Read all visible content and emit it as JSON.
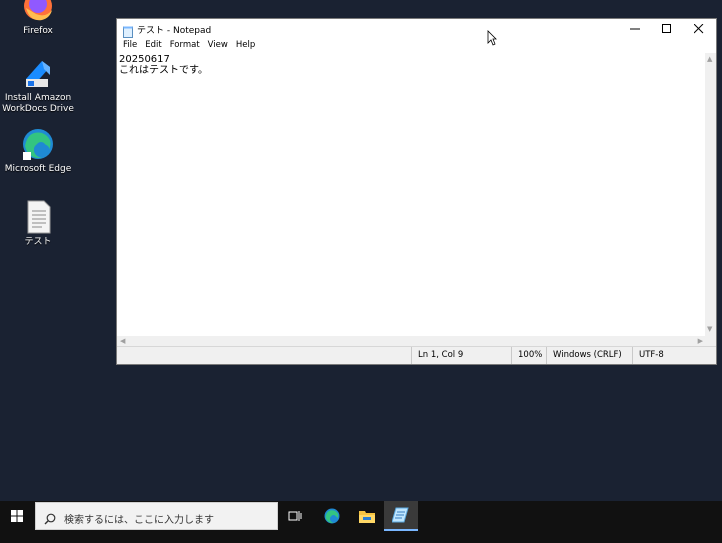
{
  "desktop": {
    "icons": [
      {
        "label": "Firefox",
        "icon": "firefox-icon"
      },
      {
        "label": "Install Amazon WorkDocs Drive",
        "icon": "workdocs-icon"
      },
      {
        "label": "Microsoft Edge",
        "icon": "edge-icon"
      },
      {
        "label": "テスト",
        "icon": "text-file-icon"
      }
    ]
  },
  "notepad": {
    "title": "テスト - Notepad",
    "menu": [
      "File",
      "Edit",
      "Format",
      "View",
      "Help"
    ],
    "content_lines": [
      "20250617",
      "これはテストです。"
    ],
    "status": {
      "position": "Ln 1, Col 9",
      "zoom": "100%",
      "line_ending": "Windows (CRLF)",
      "encoding": "UTF-8"
    }
  },
  "taskbar": {
    "search_placeholder": "検索するには、ここに入力します",
    "items": [
      "task-view-icon",
      "edge-icon",
      "file-explorer-icon",
      "notepad-icon"
    ]
  },
  "colors": {
    "desktop_bg": "#1a2232",
    "taskbar_bg": "#111111",
    "active_indicator": "#7ab7ff"
  }
}
